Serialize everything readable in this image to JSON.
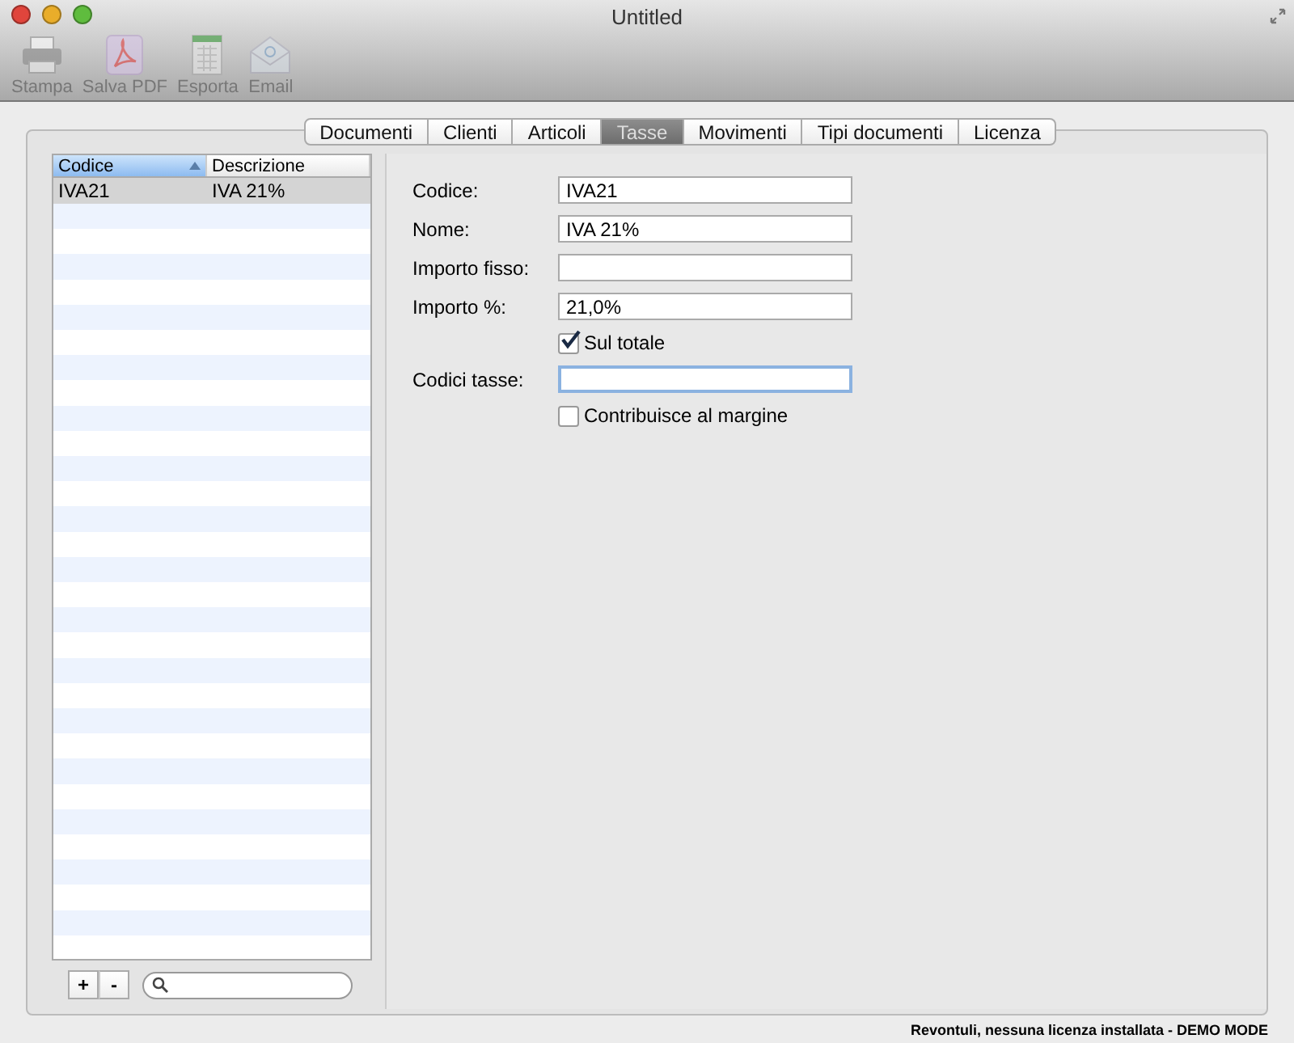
{
  "window": {
    "title": "Untitled"
  },
  "toolbar": [
    {
      "label": "Stampa",
      "kind": "printer"
    },
    {
      "label": "Salva PDF",
      "kind": "pdf"
    },
    {
      "label": "Esporta",
      "kind": "sheet"
    },
    {
      "label": "Email",
      "kind": "mail"
    }
  ],
  "tabs": [
    {
      "label": "Documenti",
      "selected": false
    },
    {
      "label": "Clienti",
      "selected": false
    },
    {
      "label": "Articoli",
      "selected": false
    },
    {
      "label": "Tasse",
      "selected": true
    },
    {
      "label": "Movimenti",
      "selected": false
    },
    {
      "label": "Tipi documenti",
      "selected": false
    },
    {
      "label": "Licenza",
      "selected": false
    }
  ],
  "table": {
    "columns": [
      {
        "label": "Codice",
        "sorted": true
      },
      {
        "label": "Descrizione",
        "sorted": false
      }
    ],
    "rows": [
      {
        "cells": [
          "IVA21",
          "IVA 21%"
        ],
        "selected": true
      }
    ]
  },
  "list_buttons": [
    "+",
    "-"
  ],
  "form": [
    {
      "kind": "text",
      "label": "Codice:",
      "value": "IVA21",
      "focused": false
    },
    {
      "kind": "text",
      "label": "Nome:",
      "value": "IVA 21%",
      "focused": false
    },
    {
      "kind": "text",
      "label": "Importo fisso:",
      "focused": false
    },
    {
      "kind": "text",
      "label": "Importo %:",
      "value": "21,0%",
      "focused": false
    },
    {
      "kind": "checkbox",
      "label": "Sul totale",
      "checked": true
    },
    {
      "kind": "text",
      "label": "Codici tasse:",
      "focused": true
    },
    {
      "kind": "checkbox",
      "label": "Contribuisce al margine",
      "checked": false
    }
  ],
  "status_bar": "Revontuli, nessuna licenza installata - DEMO MODE"
}
